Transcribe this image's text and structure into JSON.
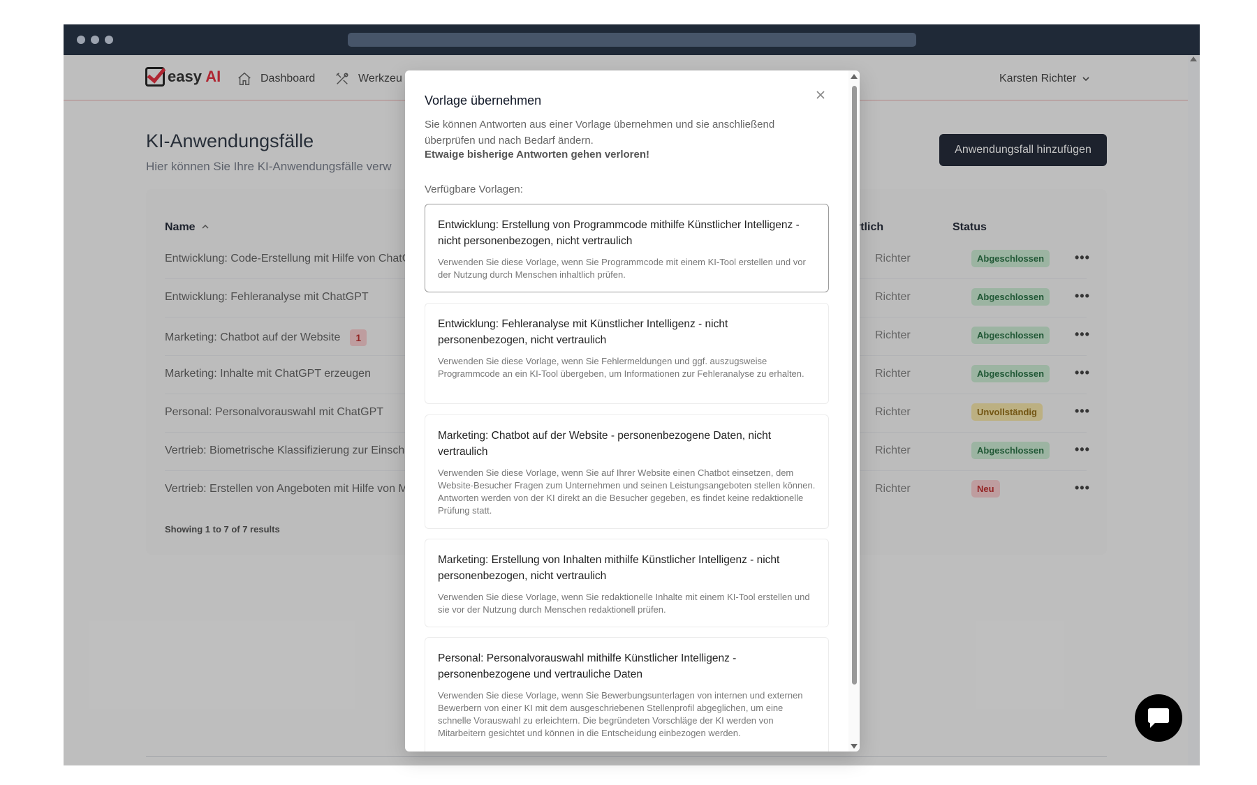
{
  "app": {
    "logo_main": "easy",
    "logo_accent": "AI"
  },
  "nav": {
    "items": [
      {
        "label": "Dashboard",
        "icon": "home-icon"
      },
      {
        "label": "Werkzeu",
        "icon": "tools-icon"
      }
    ],
    "user": "Karsten Richter"
  },
  "page": {
    "title": "KI-Anwendungsfälle",
    "subtitle": "Hier können Sie Ihre KI-Anwendungsfälle verw",
    "add_button": "Anwendungsfall hinzufügen"
  },
  "table": {
    "headers": {
      "name": "Name",
      "responsible": "rtlich",
      "status": "Status"
    },
    "rows": [
      {
        "name": "Entwicklung: Code-Erstellung mit Hilfe von ChatG",
        "responsible": "Richter",
        "status": "Abgeschlossen",
        "status_color": "green"
      },
      {
        "name": "Entwicklung: Fehleranalyse mit ChatGPT",
        "responsible": "Richter",
        "status": "Abgeschlossen",
        "status_color": "green"
      },
      {
        "name": "Marketing: Chatbot auf der Website",
        "count": "1",
        "responsible": "Richter",
        "status": "Abgeschlossen",
        "status_color": "green"
      },
      {
        "name": "Marketing: Inhalte mit ChatGPT erzeugen",
        "responsible": "Richter",
        "status": "Abgeschlossen",
        "status_color": "green"
      },
      {
        "name": "Personal: Personalvorauswahl mit ChatGPT",
        "responsible": "Richter",
        "status": "Unvollständig",
        "status_color": "yellow"
      },
      {
        "name": "Vertrieb: Biometrische Klassifizierung zur Einschät",
        "responsible": "Richter",
        "status": "Abgeschlossen",
        "status_color": "green"
      },
      {
        "name": "Vertrieb: Erstellen von Angeboten mit Hilfe von M",
        "responsible": "Richter",
        "status": "Neu",
        "status_color": "red"
      }
    ],
    "row_menu": "•••",
    "results": "Showing 1 to 7 of 7 results"
  },
  "modal": {
    "title": "Vorlage übernehmen",
    "description": "Sie können Antworten aus einer Vorlage übernehmen und sie anschließend überprüfen und nach Bedarf ändern.",
    "warning": "Etwaige bisherige Antworten gehen verloren!",
    "available_label": "Verfügbare Vorlagen:",
    "templates": [
      {
        "title": "Entwicklung: Erstellung von Programmcode mithilfe Künstlicher Intelligenz - nicht personenbezogen, nicht vertraulich",
        "description": "Verwenden Sie diese Vorlage, wenn Sie Programmcode mit einem KI-Tool erstellen und vor der Nutzung durch Menschen inhaltlich prüfen."
      },
      {
        "title": "Entwicklung: Fehleranalyse mit Künstlicher Intelligenz - nicht personenbezogen, nicht vertraulich",
        "description": "Verwenden Sie diese Vorlage, wenn Sie Fehlermeldungen und ggf. auszugsweise Programmcode an ein KI-Tool übergeben, um Informationen zur Fehleranalyse zu erhalten."
      },
      {
        "title": "Marketing: Chatbot auf der Website - personenbezogene Daten, nicht vertraulich",
        "description": "Verwenden Sie diese Vorlage, wenn Sie auf Ihrer Website einen Chatbot einsetzen, dem Website-Besucher Fragen zum Unternehmen und seinen Leistungsangeboten stellen können. Antworten werden von der KI direkt an die Besucher gegeben, es findet keine redaktionelle Prüfung statt."
      },
      {
        "title": "Marketing: Erstellung von Inhalten mithilfe Künstlicher Intelligenz - nicht personenbezogen, nicht vertraulich",
        "description": "Verwenden Sie diese Vorlage, wenn Sie redaktionelle Inhalte mit einem KI-Tool erstellen und sie vor der Nutzung durch Menschen redaktionell prüfen."
      },
      {
        "title": "Personal: Personalvorauswahl mithilfe Künstlicher Intelligenz - personenbezogene und vertrauliche Daten",
        "description": "Verwenden Sie diese Vorlage, wenn Sie Bewerbungsunterlagen von internen und externen Bewerbern von einer KI mit dem ausgeschriebenen Stellenprofil abgeglichen, um eine schnelle Vorauswahl zu erleichtern. Die begründeten Vorschläge der KI werden von Mitarbeitern gesichtet und können in die Entscheidung einbezogen werden."
      }
    ]
  },
  "colors": {
    "accent": "#e11d2e",
    "button_dark": "#111827",
    "status_green": "#c6e9cf",
    "status_yellow": "#f4e2a1",
    "status_red": "#f7c8cb"
  }
}
